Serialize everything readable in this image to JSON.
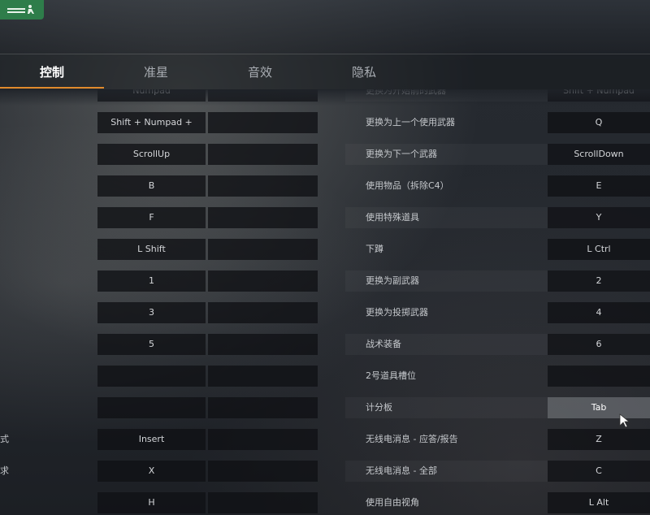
{
  "tabs": [
    {
      "label": "控制",
      "active": true
    },
    {
      "label": "准星",
      "active": false
    },
    {
      "label": "音效",
      "active": false
    },
    {
      "label": "隐私",
      "active": false
    }
  ],
  "left_rows": [
    {
      "action": "",
      "key1": "Numpad",
      "key2": ""
    },
    {
      "action": "",
      "key1": "Shift + Numpad +",
      "key2": ""
    },
    {
      "action": "",
      "key1": "ScrollUp",
      "key2": ""
    },
    {
      "action": "",
      "key1": "B",
      "key2": ""
    },
    {
      "action": "",
      "key1": "F",
      "key2": ""
    },
    {
      "action": "",
      "key1": "L Shift",
      "key2": ""
    },
    {
      "action": "",
      "key1": "1",
      "key2": ""
    },
    {
      "action": "",
      "key1": "3",
      "key2": ""
    },
    {
      "action": "",
      "key1": "5",
      "key2": ""
    },
    {
      "action": "",
      "key1": "",
      "key2": ""
    },
    {
      "action": "",
      "key1": "",
      "key2": ""
    },
    {
      "action": "式",
      "key1": "Insert",
      "key2": ""
    },
    {
      "action": "求",
      "key1": "X",
      "key2": ""
    },
    {
      "action": "",
      "key1": "H",
      "key2": ""
    }
  ],
  "right_rows": [
    {
      "action": "更换为开始前的武器",
      "key1": "Shift + Numpad"
    },
    {
      "action": "更换为上一个使用武器",
      "key1": "Q"
    },
    {
      "action": "更换为下一个武器",
      "key1": "ScrollDown"
    },
    {
      "action": "使用物品（拆除C4）",
      "key1": "E"
    },
    {
      "action": "使用特殊道具",
      "key1": "Y"
    },
    {
      "action": "下蹲",
      "key1": "L Ctrl"
    },
    {
      "action": "更换为副武器",
      "key1": "2"
    },
    {
      "action": "更换为投掷武器",
      "key1": "4"
    },
    {
      "action": "战术装备",
      "key1": "6"
    },
    {
      "action": "2号道具槽位",
      "key1": ""
    },
    {
      "action": "计分板",
      "key1": "Tab",
      "highlight": true
    },
    {
      "action": "无线电消息 - 应答/报告",
      "key1": "Z"
    },
    {
      "action": "无线电消息 - 全部",
      "key1": "C"
    },
    {
      "action": "使用自由视角",
      "key1": "L Alt"
    }
  ],
  "colors": {
    "accent": "#e08a2c",
    "badge": "#2e7d4a"
  },
  "icons": {
    "badge": "exit-icon",
    "cursor": "mouse-cursor-icon"
  }
}
